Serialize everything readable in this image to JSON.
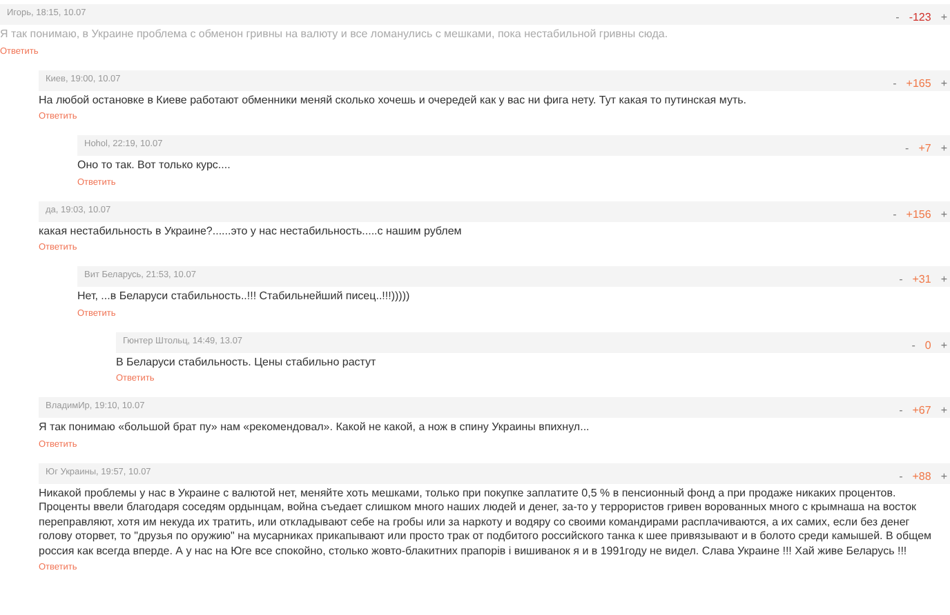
{
  "comments": [
    {
      "author": "Игорь, 18:15, 10.07",
      "score": "-123",
      "faded": true,
      "text": "Я так понимаю, в Украине проблема с обменон гривны на валюту и все ломанулись с мешками, пока нестабильной гривны сюда.",
      "reply": "Ответить",
      "minus": "-",
      "plus": "+",
      "children": [
        {
          "author": "Киев, 19:00, 10.07",
          "score": "+165",
          "faded": false,
          "text": "На любой остановке в Киеве работают обменники меняй сколько хочешь и очередей как у вас ни фига нету. Тут какая то путинская муть.",
          "reply": "Ответить",
          "minus": "-",
          "plus": "+",
          "children": [
            {
              "author": "Hohol, 22:19, 10.07",
              "score": "+7",
              "faded": false,
              "text": "Оно то так. Вот только курс....",
              "reply": "Ответить",
              "minus": "-",
              "plus": "+"
            }
          ]
        },
        {
          "author": "да, 19:03, 10.07",
          "score": "+156",
          "faded": false,
          "text": "какая нестабильность в Украине?......это у нас нестабильность.....с нашим рублем",
          "reply": "Ответить",
          "minus": "-",
          "plus": "+",
          "children": [
            {
              "author": "Вит Беларусь, 21:53, 10.07",
              "score": "+31",
              "faded": false,
              "text": "Нет, ...в Беларуси стабильность..!!! Стабильнейший писец..!!!)))))",
              "reply": "Ответить",
              "minus": "-",
              "plus": "+",
              "children": [
                {
                  "author": "Гюнтер Штольц, 14:49, 13.07",
                  "score": "0",
                  "faded": false,
                  "text": "В Беларуси стабильность. Цены стабильно растут",
                  "reply": "Ответить",
                  "minus": "-",
                  "plus": "+"
                }
              ]
            }
          ]
        },
        {
          "author": "ВладимИр, 19:10, 10.07",
          "score": "+67",
          "faded": false,
          "text": "Я так понимаю «большой брат пу» нам «рекомендовал». Какой не какой, а нож в спину Украины впихнул...",
          "reply": "Ответить",
          "minus": "-",
          "plus": "+"
        },
        {
          "author": "Юг Украины, 19:57, 10.07",
          "score": "+88",
          "faded": false,
          "text": "Никакой проблемы у нас в Украине с валютой нет, меняйте хоть мешками, только при покупке заплатите 0,5 % в пенсионный фонд а при продаже никаких процентов. Проценты ввели благодаря соседям ордынцам, война съедает слишком много наших людей и денег, за-то у террористов гривен ворованных много с крымнаша на восток переправляют, хотя им некуда их тратить, или откладывают себе на гробы или за наркоту и водяру со своими командирами расплачиваются, а их самих, если без денег голову оторвет, то \"друзья по оружию\" на мусарниках прикапывают или просто трак от подбитого российского танка к шее привязывают и в болото среди камышей. В общем россия как всегда вперде. А у нас на Юге все спокойно, столько жовто-блакитних прапорів і вишиванок я и в 1991году не видел. Слава Украине !!! Хай живе Беларусь !!!",
          "reply": "Ответить",
          "minus": "-",
          "plus": "+"
        }
      ]
    }
  ]
}
